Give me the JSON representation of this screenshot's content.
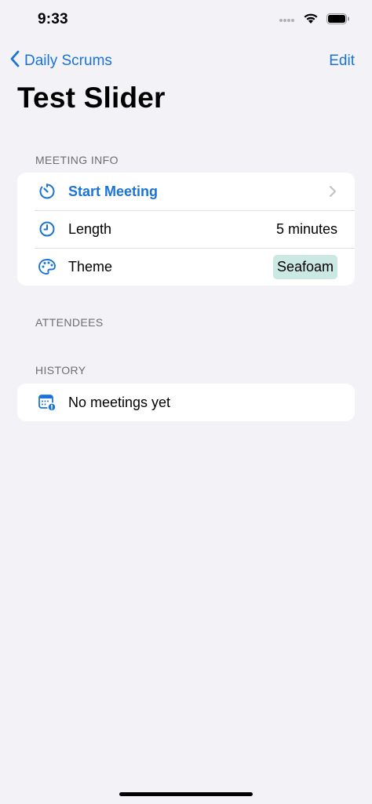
{
  "status_bar": {
    "time": "9:33"
  },
  "nav": {
    "back_label": "Daily Scrums",
    "edit_label": "Edit"
  },
  "title": "Test Slider",
  "sections": {
    "meeting_info": {
      "header": "MEETING INFO",
      "start_meeting_label": "Start Meeting",
      "length_label": "Length",
      "length_value": "5 minutes",
      "theme_label": "Theme",
      "theme_value": "Seafoam",
      "theme_color": "#cce8e2"
    },
    "attendees": {
      "header": "ATTENDEES"
    },
    "history": {
      "header": "HISTORY",
      "empty_label": "No meetings yet"
    }
  },
  "colors": {
    "accent": "#1a73d8",
    "background": "#f2f2f7"
  },
  "icons": {
    "start_meeting": "timer-icon",
    "length": "clock-icon",
    "theme": "palette-icon",
    "history": "calendar-badge-exclamation-icon"
  }
}
